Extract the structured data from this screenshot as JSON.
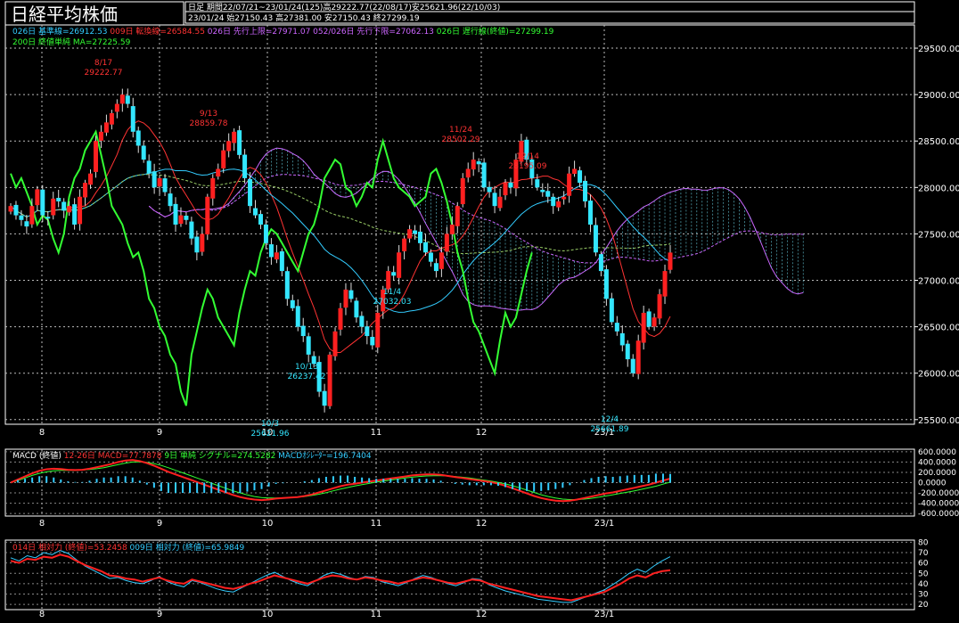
{
  "title": "日経平均株価",
  "header": {
    "line1": "日足  期間22/07/21~23/01/24(125)高29222.77(22/08/17)安25621.96(22/10/03)",
    "line2": "23/01/24   始27150.43 高27381.00 安27150.43 終27299.19"
  },
  "legend_line1": [
    {
      "text": "026日 基準線=26912.53",
      "color": "#33ccff"
    },
    {
      "text": "009日 転換線=26584.55",
      "color": "#ff3333"
    },
    {
      "text": "026日 先行上限=27971.07",
      "color": "#cc66ff"
    },
    {
      "text": "052/026日 先行下限=27062.13",
      "color": "#cc66ff"
    },
    {
      "text": "026日 遅行線(終値)=27299.19",
      "color": "#33ff33"
    }
  ],
  "legend_line2": [
    {
      "text": "200日 終値単純 MA=27225.59",
      "color": "#33ff33"
    }
  ],
  "macd_legend": [
    {
      "text": "MACD (終値)",
      "color": "#ffffff"
    },
    {
      "text": "12-26日 MACD=77.7878",
      "color": "#ff3333"
    },
    {
      "text": "9日 単純 シグナル=274.5282",
      "color": "#33ff33"
    },
    {
      "text": "MACDｵｼﾚｰﾀｰ=196.7404",
      "color": "#33ccff"
    }
  ],
  "rsi_legend": [
    {
      "text": "014日 相対力 (終値)=53.2458",
      "color": "#ff3333"
    },
    {
      "text": "009日 相対力 (終値)=65.9849",
      "color": "#33ccff"
    }
  ],
  "annotations": [
    {
      "date": "8/17",
      "value": "29222.77"
    },
    {
      "date": "9/13",
      "value": "28859.78"
    },
    {
      "date": "11/24",
      "value": "28502.29"
    },
    {
      "date": "12/14",
      "value": "28195.09"
    },
    {
      "date": "10/13",
      "value": "26237.42"
    },
    {
      "date": "11/4",
      "value": "27032.03"
    },
    {
      "date": "10/3",
      "value": "25621.96"
    },
    {
      "date": "12/4",
      "value": "25661.89"
    }
  ],
  "chart_data": [
    {
      "type": "candlestick",
      "y_ticks": [
        "29500.00",
        "29000.00",
        "28500.00",
        "28000.00",
        "27500.00",
        "27000.00",
        "26500.00",
        "26000.00",
        "25500.00"
      ],
      "ylim": [
        25450,
        29750
      ],
      "x_ticks": [
        "8",
        "9",
        "10",
        "11",
        "12",
        "23/1"
      ],
      "close": [
        27800,
        27700,
        27650,
        27580,
        27800,
        27980,
        27700,
        27680,
        27880,
        27850,
        27750,
        27800,
        27600,
        27900,
        28050,
        28150,
        28500,
        28600,
        28700,
        28800,
        28900,
        29000,
        28900,
        28600,
        28450,
        28300,
        28150,
        28000,
        28100,
        27950,
        27800,
        27600,
        27700,
        27650,
        27450,
        27300,
        27500,
        27900,
        28100,
        28200,
        28400,
        28500,
        28600,
        28350,
        28100,
        27800,
        27700,
        27600,
        27400,
        27250,
        27300,
        27100,
        26800,
        26700,
        26500,
        26400,
        26200,
        26100,
        25800,
        25650,
        26200,
        26450,
        26700,
        26900,
        26800,
        26600,
        26500,
        26400,
        26300,
        26650,
        26900,
        27100,
        27050,
        27300,
        27450,
        27550,
        27500,
        27400,
        27300,
        27200,
        27100,
        27300,
        27500,
        27600,
        27800,
        28100,
        28200,
        28300,
        28250,
        28000,
        27950,
        27800,
        27900,
        28050,
        28000,
        28300,
        28500,
        28300,
        28100,
        28000,
        27950,
        27900,
        27800,
        27850,
        27900,
        28150,
        28200,
        28050,
        27850,
        27600,
        27300,
        27100,
        26800,
        26550,
        26450,
        26300,
        26150,
        26000,
        26350,
        26650,
        26500,
        26600,
        26850,
        27100,
        27299
      ]
    },
    {
      "type": "line",
      "name": "MACD (終値)",
      "y_ticks": [
        "600.0000",
        "400.0000",
        "200.0000",
        "0.0000",
        "-200.0000",
        "-400.0000",
        "-600.0000"
      ],
      "ylim": [
        -650,
        650
      ],
      "macd": [
        0,
        60,
        120,
        180,
        230,
        260,
        270,
        265,
        250,
        245,
        250,
        270,
        300,
        330,
        360,
        400,
        430,
        440,
        420,
        380,
        330,
        270,
        210,
        160,
        110,
        60,
        10,
        -40,
        -90,
        -140,
        -190,
        -240,
        -280,
        -310,
        -330,
        -340,
        -330,
        -310,
        -300,
        -290,
        -280,
        -260,
        -230,
        -190,
        -150,
        -110,
        -70,
        -40,
        -20,
        0,
        20,
        40,
        60,
        80,
        100,
        120,
        140,
        150,
        160,
        160,
        150,
        130,
        110,
        90,
        70,
        50,
        30,
        10,
        -20,
        -60,
        -110,
        -160,
        -210,
        -260,
        -300,
        -330,
        -350,
        -360,
        -350,
        -330,
        -300,
        -270,
        -240,
        -210,
        -190,
        -160,
        -130,
        -100,
        -70,
        -40,
        0,
        40,
        78
      ],
      "signal": [
        0,
        40,
        90,
        140,
        180,
        210,
        230,
        240,
        240,
        240,
        245,
        255,
        270,
        290,
        320,
        350,
        380,
        400,
        405,
        395,
        370,
        335,
        290,
        240,
        190,
        140,
        90,
        40,
        -10,
        -60,
        -110,
        -160,
        -200,
        -240,
        -270,
        -290,
        -300,
        -300,
        -295,
        -290,
        -280,
        -270,
        -250,
        -225,
        -195,
        -160,
        -125,
        -95,
        -65,
        -40,
        -15,
        10,
        30,
        50,
        70,
        90,
        105,
        120,
        130,
        135,
        135,
        130,
        120,
        105,
        90,
        70,
        50,
        30,
        5,
        -25,
        -60,
        -100,
        -145,
        -190,
        -235,
        -270,
        -300,
        -320,
        -330,
        -330,
        -320,
        -305,
        -285,
        -260,
        -235,
        -210,
        -185,
        -160,
        -130,
        -100,
        -70,
        -30,
        10
      ]
    },
    {
      "type": "line",
      "name": "相対力",
      "y_ticks": [
        "80",
        "70",
        "60",
        "50",
        "40",
        "30",
        "20"
      ],
      "ylim": [
        15,
        82
      ],
      "rsi14": [
        62,
        60,
        64,
        63,
        66,
        65,
        68,
        66,
        62,
        58,
        55,
        52,
        48,
        47,
        45,
        44,
        42,
        44,
        46,
        43,
        41,
        40,
        44,
        42,
        40,
        38,
        36,
        35,
        37,
        40,
        42,
        45,
        48,
        46,
        44,
        42,
        40,
        43,
        46,
        48,
        47,
        45,
        44,
        46,
        45,
        43,
        42,
        40,
        42,
        44,
        46,
        45,
        43,
        41,
        40,
        42,
        44,
        43,
        40,
        38,
        36,
        34,
        32,
        30,
        28,
        27,
        26,
        25,
        24,
        26,
        28,
        30,
        32,
        36,
        40,
        45,
        48,
        46,
        50,
        52,
        53
      ],
      "rsi9": [
        65,
        62,
        67,
        65,
        70,
        68,
        72,
        69,
        63,
        57,
        53,
        49,
        45,
        46,
        43,
        41,
        40,
        43,
        47,
        42,
        39,
        37,
        43,
        41,
        38,
        35,
        33,
        32,
        36,
        40,
        44,
        48,
        51,
        47,
        43,
        40,
        38,
        43,
        48,
        51,
        49,
        46,
        44,
        47,
        46,
        42,
        40,
        38,
        41,
        45,
        48,
        46,
        43,
        40,
        38,
        41,
        45,
        44,
        39,
        36,
        33,
        31,
        29,
        27,
        25,
        24,
        23,
        22,
        22,
        25,
        28,
        31,
        34,
        39,
        44,
        50,
        54,
        51,
        57,
        62,
        66
      ]
    }
  ]
}
